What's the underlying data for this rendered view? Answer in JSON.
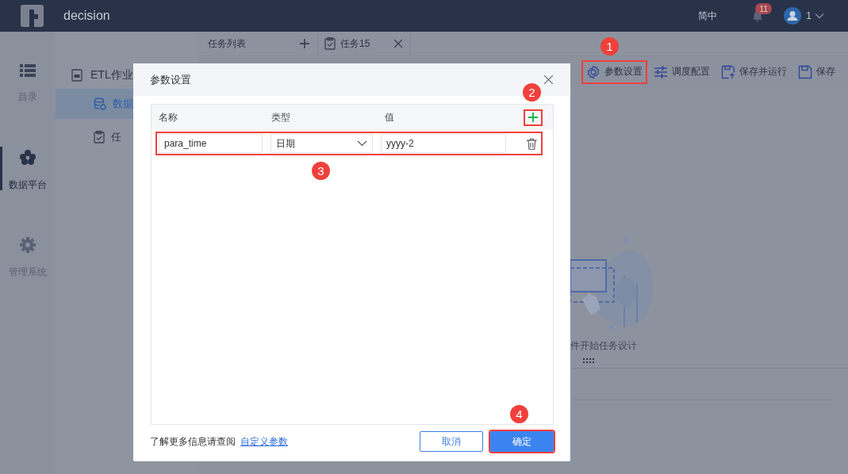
{
  "top_bar": {
    "app_name": "decision",
    "language": "简中",
    "notification_count": "11",
    "user_name": "1"
  },
  "nav": [
    {
      "label": "目录",
      "kind": "list",
      "selected": false
    },
    {
      "label": "数据平台",
      "kind": "cube",
      "selected": true
    },
    {
      "label": "管理系统",
      "kind": "gear",
      "selected": false
    }
  ],
  "sub_nav": [
    {
      "label": "ETL作业",
      "kind": "etl",
      "children": [
        {
          "label": "数据",
          "kind": "database",
          "selected": true
        },
        {
          "label": "任",
          "kind": "task",
          "selected": false
        }
      ]
    }
  ],
  "tabs": [
    {
      "label": "任务列表",
      "kind": "list"
    },
    {
      "label": "任务15",
      "kind": "task"
    }
  ],
  "toolbar": [
    {
      "label": "参数设置",
      "kind": "settings",
      "highlighted": true
    },
    {
      "label": "调度配置",
      "kind": "schedule",
      "highlighted": false
    },
    {
      "label": "保存并运行",
      "kind": "save-run",
      "highlighted": false
    },
    {
      "label": "保存",
      "kind": "save",
      "highlighted": false
    }
  ],
  "canvas": {
    "hint": "件开始任务设计"
  },
  "dialog": {
    "title": "参数设置",
    "columns": [
      "名称",
      "类型",
      "值"
    ],
    "add_button": {
      "highlighted": true
    },
    "rows": [
      {
        "name": "para_time",
        "type": "日期",
        "value": "yyyy-2",
        "highlighted": true
      }
    ],
    "help_text": "了解更多信息请查阅",
    "help_link": "自定义参数",
    "buttons": [
      {
        "label": "取消",
        "kind": "secondary",
        "highlighted": false
      },
      {
        "label": "确定",
        "kind": "primary",
        "highlighted": true
      }
    ]
  },
  "annotations": [
    {
      "label": "1"
    },
    {
      "label": "2"
    },
    {
      "label": "3"
    },
    {
      "label": "4"
    }
  ]
}
